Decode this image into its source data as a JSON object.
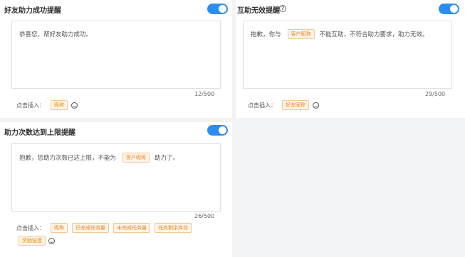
{
  "cards": {
    "friend_success": {
      "title": "好友助力成功提醒",
      "message_text": "恭喜您，帮好友助力成功。",
      "counter": "12/500",
      "insert_label": "点击插入：",
      "chips": [
        "昵称"
      ],
      "emoji_icon": "smile-icon",
      "toggle_on": true
    },
    "mutual_invalid": {
      "title": "互助无效提醒",
      "help_icon": "question-circle-icon",
      "message_before": "抱歉，你与",
      "message_chip": "客户昵称",
      "message_after": "不能互助，不符合助力要求，助力无效。",
      "counter": "29/500",
      "insert_label": "点击插入：",
      "chips": [
        "好友昵称"
      ],
      "emoji_icon": "smile-icon",
      "toggle_on": true
    },
    "limit_reached": {
      "title": "助力次数达到上限提醒",
      "message_before": "抱歉，您助力次数已达上限，不能为",
      "message_chip": "客户昵称",
      "message_after": "助力了。",
      "counter": "26/500",
      "insert_label": "点击插入：",
      "chips": [
        "昵称",
        "已完成任务量",
        "未完成任务量",
        "任务剩余库存",
        "奖励链接"
      ],
      "emoji_icon": "smile-icon",
      "toggle_on": true
    }
  },
  "colors": {
    "accent": "#2d8cf0",
    "chip_text": "#e8892b",
    "chip_border": "#f5c791",
    "chip_bg": "#fdf4e7",
    "page_bg": "#f2f3f5"
  }
}
